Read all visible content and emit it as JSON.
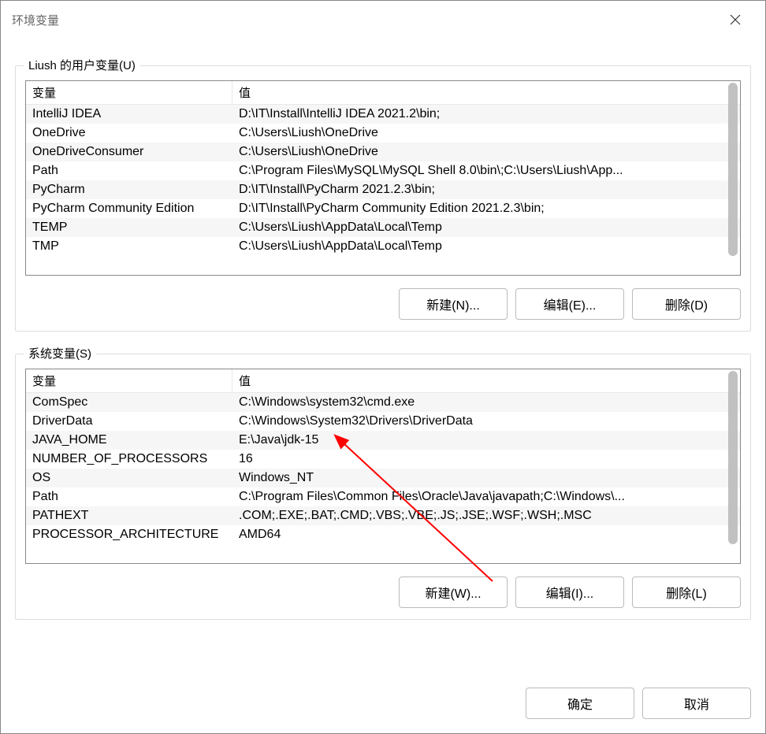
{
  "window": {
    "title": "环境变量"
  },
  "userVars": {
    "legend": "Liush 的用户变量(U)",
    "headers": {
      "name": "变量",
      "value": "值"
    },
    "rows": [
      {
        "name": "IntelliJ IDEA",
        "value": "D:\\IT\\Install\\IntelliJ IDEA 2021.2\\bin;"
      },
      {
        "name": "OneDrive",
        "value": "C:\\Users\\Liush\\OneDrive"
      },
      {
        "name": "OneDriveConsumer",
        "value": "C:\\Users\\Liush\\OneDrive"
      },
      {
        "name": "Path",
        "value": "C:\\Program Files\\MySQL\\MySQL Shell 8.0\\bin\\;C:\\Users\\Liush\\App..."
      },
      {
        "name": "PyCharm",
        "value": "D:\\IT\\Install\\PyCharm 2021.2.3\\bin;"
      },
      {
        "name": "PyCharm Community Edition",
        "value": "D:\\IT\\Install\\PyCharm Community Edition 2021.2.3\\bin;"
      },
      {
        "name": "TEMP",
        "value": "C:\\Users\\Liush\\AppData\\Local\\Temp"
      },
      {
        "name": "TMP",
        "value": "C:\\Users\\Liush\\AppData\\Local\\Temp"
      }
    ],
    "buttons": {
      "new": "新建(N)...",
      "edit": "编辑(E)...",
      "delete": "删除(D)"
    }
  },
  "sysVars": {
    "legend": "系统变量(S)",
    "headers": {
      "name": "变量",
      "value": "值"
    },
    "rows": [
      {
        "name": "ComSpec",
        "value": "C:\\Windows\\system32\\cmd.exe"
      },
      {
        "name": "DriverData",
        "value": "C:\\Windows\\System32\\Drivers\\DriverData"
      },
      {
        "name": "JAVA_HOME",
        "value": "E:\\Java\\jdk-15"
      },
      {
        "name": "NUMBER_OF_PROCESSORS",
        "value": "16"
      },
      {
        "name": "OS",
        "value": "Windows_NT"
      },
      {
        "name": "Path",
        "value": "C:\\Program Files\\Common Files\\Oracle\\Java\\javapath;C:\\Windows\\..."
      },
      {
        "name": "PATHEXT",
        "value": ".COM;.EXE;.BAT;.CMD;.VBS;.VBE;.JS;.JSE;.WSF;.WSH;.MSC"
      },
      {
        "name": "PROCESSOR_ARCHITECTURE",
        "value": "AMD64"
      }
    ],
    "buttons": {
      "new": "新建(W)...",
      "edit": "编辑(I)...",
      "delete": "删除(L)"
    }
  },
  "footer": {
    "ok": "确定",
    "cancel": "取消"
  }
}
